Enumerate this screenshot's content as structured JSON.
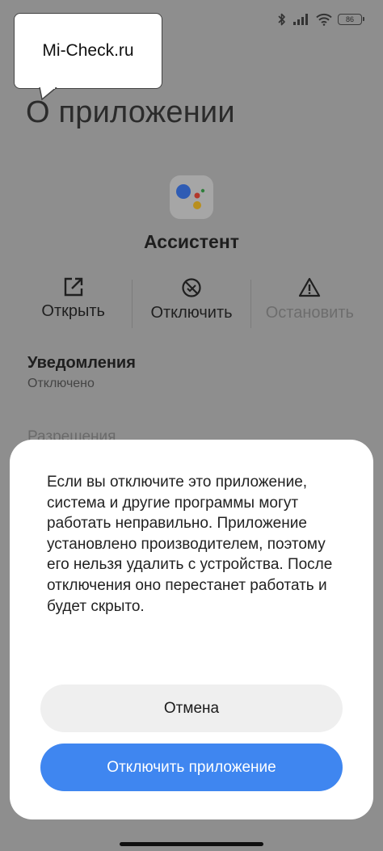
{
  "status_bar": {
    "battery_level": "86"
  },
  "watermark": {
    "text": "Mi-Check.ru"
  },
  "header": {
    "title": "О приложении"
  },
  "app": {
    "name": "Ассистент",
    "icon": "google-assistant-icon"
  },
  "actions": [
    {
      "label": "Открыть",
      "icon": "open-external-icon",
      "enabled": true
    },
    {
      "label": "Отключить",
      "icon": "disable-icon",
      "enabled": true
    },
    {
      "label": "Остановить",
      "icon": "warning-icon",
      "enabled": false
    }
  ],
  "notifications": {
    "title": "Уведомления",
    "value": "Отключено"
  },
  "permissions": {
    "title": "Разрешения"
  },
  "dialog": {
    "message": "Если вы отключите это приложение, система и другие программы могут работать неправильно. Приложение установлено производителем, поэтому его нельзя удалить с устройства. После отключения оно перестанет работать и будет скрыто.",
    "cancel_label": "Отмена",
    "confirm_label": "Отключить приложение"
  },
  "colors": {
    "overlay": "#8e8e8e",
    "primary_button": "#3f86f0",
    "secondary_button": "#efefef"
  }
}
